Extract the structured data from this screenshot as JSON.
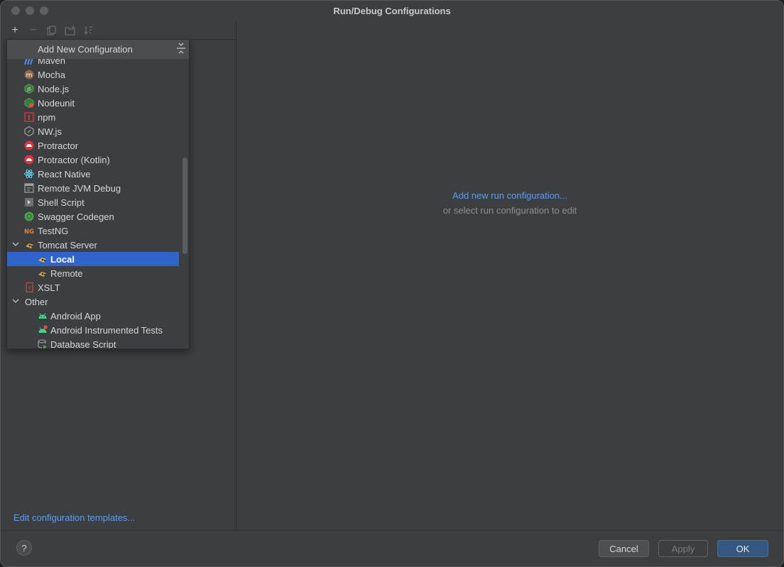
{
  "window": {
    "title": "Run/Debug Configurations"
  },
  "toolbar": {
    "add": "+",
    "remove": "−"
  },
  "popup": {
    "title": "Add New Configuration",
    "items": [
      {
        "label": "Maven",
        "icon": "maven-icon"
      },
      {
        "label": "Mocha",
        "icon": "mocha-icon"
      },
      {
        "label": "Node.js",
        "icon": "nodejs-icon"
      },
      {
        "label": "Nodeunit",
        "icon": "nodeunit-icon"
      },
      {
        "label": "npm",
        "icon": "npm-icon"
      },
      {
        "label": "NW.js",
        "icon": "nwjs-icon"
      },
      {
        "label": "Protractor",
        "icon": "protractor-icon"
      },
      {
        "label": "Protractor (Kotlin)",
        "icon": "protractor-icon"
      },
      {
        "label": "React Native",
        "icon": "react-icon"
      },
      {
        "label": "Remote JVM Debug",
        "icon": "remote-debug-icon"
      },
      {
        "label": "Shell Script",
        "icon": "shell-script-icon"
      },
      {
        "label": "Swagger Codegen",
        "icon": "swagger-icon"
      },
      {
        "label": "TestNG",
        "icon": "testng-icon"
      },
      {
        "label": "Tomcat Server",
        "icon": "tomcat-icon",
        "expanded": true
      },
      {
        "label": "Local",
        "icon": "tomcat-icon",
        "selected": true
      },
      {
        "label": "Remote",
        "icon": "tomcat-icon"
      },
      {
        "label": "XSLT",
        "icon": "xslt-icon"
      },
      {
        "label": "Other",
        "expanded": true
      },
      {
        "label": "Android App",
        "icon": "android-icon"
      },
      {
        "label": "Android Instrumented Tests",
        "icon": "android-test-icon"
      },
      {
        "label": "Database Script",
        "icon": "database-script-icon"
      }
    ]
  },
  "left": {
    "templates_link": "Edit configuration templates..."
  },
  "main": {
    "add_link": "Add new run configuration...",
    "hint": "or select run configuration to edit"
  },
  "footer": {
    "help": "?",
    "cancel": "Cancel",
    "apply": "Apply",
    "ok": "OK"
  },
  "colors": {
    "accent": "#589df6",
    "selection": "#2f65ca",
    "ok_button": "#365880"
  }
}
